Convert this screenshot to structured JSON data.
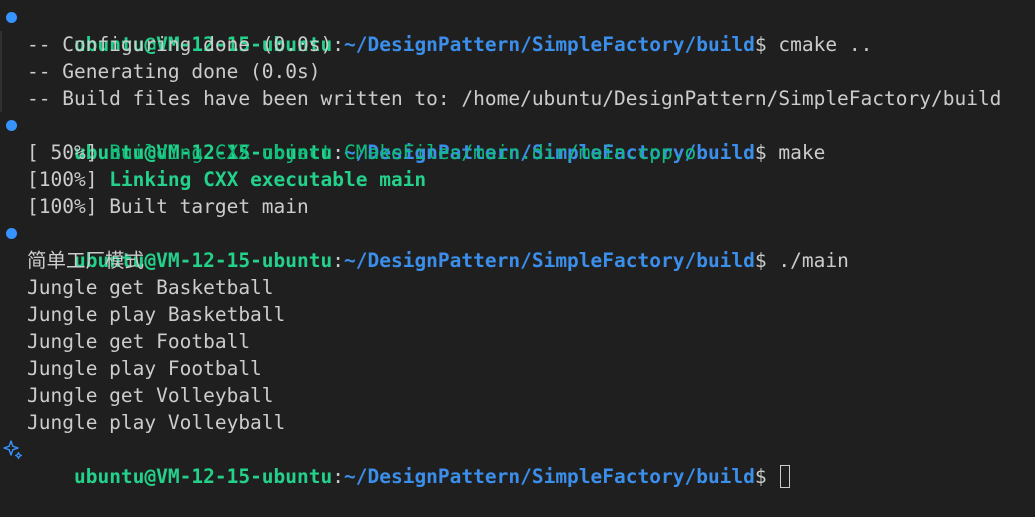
{
  "prompt": {
    "user_host": "ubuntu@VM-12-15-ubuntu",
    "colon": ":",
    "path": "~/DesignPattern/SimpleFactory/build",
    "dollar": "$"
  },
  "colors": {
    "background": "#1f1f1f",
    "user": "#23d18b",
    "path": "#3b8eea",
    "text": "#cccccc",
    "green": "#0dbc79",
    "dot": "#3794ff",
    "sparkle": "#3794ff"
  },
  "icons": {
    "command_status": "circle-dot-icon",
    "prompt_sparkle": "sparkle-icon"
  },
  "commands": [
    {
      "command": " cmake ..",
      "output": [
        "-- Configuring done (0.0s)",
        "-- Generating done (0.0s)",
        "-- Build files have been written to: /home/ubuntu/DesignPattern/SimpleFactory/build"
      ]
    },
    {
      "command": " make",
      "output": [
        {
          "prefix": "[ 50%] ",
          "text": "Building CXX object CMakeFiles/main.dir/main.cpp.o"
        },
        {
          "prefix": "[100%] ",
          "text": "Linking CXX executable main"
        },
        {
          "prefix": "[100%] ",
          "text": "Built target main"
        }
      ]
    },
    {
      "command": " ./main",
      "output": [
        "简单工厂模式",
        "Jungle get Basketball",
        "Jungle play Basketball",
        "Jungle get Football",
        "Jungle play Football",
        "Jungle get Volleyball",
        "Jungle play Volleyball"
      ]
    }
  ],
  "current_input": " "
}
